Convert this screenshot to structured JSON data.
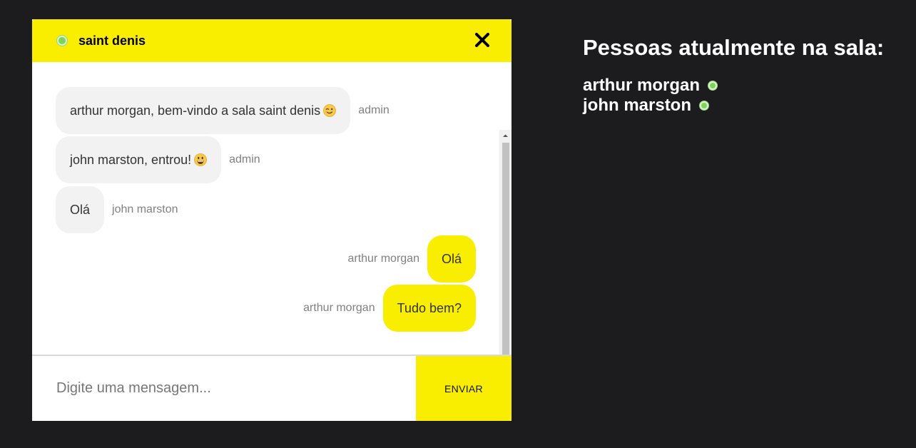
{
  "room": {
    "name": "saint denis",
    "close_icon": "close-icon"
  },
  "messages": [
    {
      "text": "arthur morgan, bem-vindo a sala saint denis",
      "emoji": "wink-emoji",
      "sender": "admin",
      "side": "left"
    },
    {
      "text": "john marston, entrou!",
      "emoji": "grin-emoji",
      "sender": "admin",
      "side": "left"
    },
    {
      "text": "Olá",
      "sender": "john marston",
      "side": "left"
    },
    {
      "text": "Olá",
      "sender": "arthur morgan",
      "side": "right"
    },
    {
      "text": "Tudo bem?",
      "sender": "arthur morgan",
      "side": "right"
    }
  ],
  "composer": {
    "placeholder": "Digite uma mensagem...",
    "value": "",
    "send_label": "ENVIAR"
  },
  "people": {
    "title": "Pessoas atualmente na sala:",
    "list": [
      "arthur morgan",
      "john marston"
    ]
  },
  "colors": {
    "accent": "#f9ee00",
    "background": "#1c1c1e",
    "online": "#7fd35a"
  }
}
